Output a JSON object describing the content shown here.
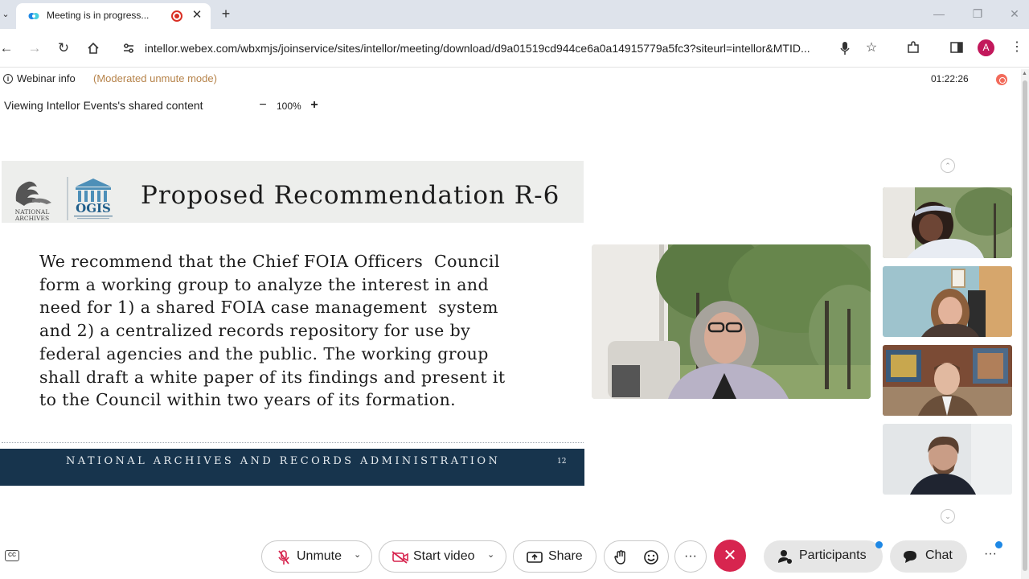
{
  "browser": {
    "tab_title": "Meeting is in progress...",
    "url": "intellor.webex.com/wbxmjs/joinservice/sites/intellor/meeting/download/d9a01519cd944ce6a0a14915779a5fc3?siteurl=intellor&MTID...",
    "profile_initial": "A",
    "icons": [
      "tab-list-icon",
      "webex-logo-icon",
      "recording-icon",
      "close-icon",
      "new-tab-icon",
      "back-icon",
      "forward-icon",
      "reload-icon",
      "home-icon",
      "site-settings-icon",
      "microphone-icon",
      "bookmark-star-icon",
      "extensions-icon",
      "side-panel-icon",
      "menu-icon"
    ]
  },
  "meeting": {
    "info_label": "Webinar info",
    "mode_label": "(Moderated unmute mode)",
    "timer": "01:22:26",
    "share_label": "Viewing Intellor Events's shared content",
    "zoom_minus": "−",
    "zoom_level": "100%",
    "zoom_plus": "+"
  },
  "slide": {
    "logo_left_text": [
      "NATIONAL",
      "ARCHIVES"
    ],
    "logo_right_text": "OGIS",
    "title": "Proposed Recommendation R-6",
    "body_lines": [
      "We recommend that the Chief FOIA Officers  Council",
      "form a working group to analyze the interest in and",
      "need for 1) a shared FOIA case management  system",
      "and 2) a centralized records repository for use by",
      "federal agencies and the public. The working group",
      "shall draft a white paper of its findings and present it",
      "to the Council within two years of its formation."
    ],
    "footer": "NATIONAL ARCHIVES AND RECORDS ADMINISTRATION",
    "page_number": "12"
  },
  "controls": {
    "unmute": "Unmute",
    "start_video": "Start video",
    "share": "Share",
    "participants": "Participants",
    "chat": "Chat",
    "more": "···",
    "end": "✕"
  },
  "colors": {
    "accent_red": "#d7254f",
    "slide_footer": "#17344d",
    "mode_label": "#b6834a",
    "notification": "#1e88e5"
  }
}
